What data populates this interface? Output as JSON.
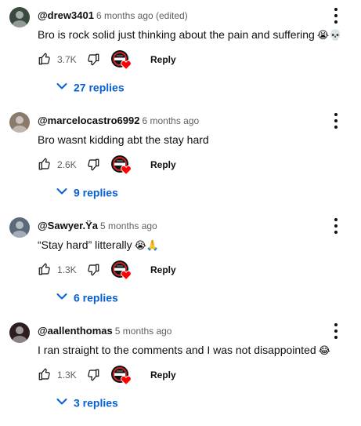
{
  "comments": [
    {
      "author": "@drew3401",
      "meta": "6 months ago (edited)",
      "text": "Bro is rock solid just thinking about the pain and suffering",
      "emojis": "😭💀",
      "likes": "3.7K",
      "reply_label": "Reply",
      "replies_label": "27 replies",
      "avatar_color": "#3a4a3f"
    },
    {
      "author": "@marcelocastro6992",
      "meta": "6 months ago",
      "text": "Bro wasnt kidding abt the stay hard",
      "emojis": "",
      "likes": "2.6K",
      "reply_label": "Reply",
      "replies_label": "9 replies",
      "avatar_color": "#8a7a6a"
    },
    {
      "author": "@Sawyer.Ÿa",
      "meta": "5 months ago",
      "text": "“Stay hard” litterally",
      "emojis": "😭🙏",
      "likes": "1.3K",
      "reply_label": "Reply",
      "replies_label": "6 replies",
      "avatar_color": "#5a6a78"
    },
    {
      "author": "@aallenthomas",
      "meta": "5 months ago",
      "text": "I ran straight to the comments and I was not disappointed",
      "emojis": "😂",
      "likes": "1.3K",
      "reply_label": "Reply",
      "replies_label": "3 replies",
      "avatar_color": "#2c1e1e"
    }
  ],
  "icons": {
    "like": "thumbs-up-icon",
    "dislike": "thumbs-down-icon",
    "more": "kebab-menu-icon",
    "expand": "chevron-down-icon",
    "creator_heart": "creator-heart-icon"
  },
  "colors": {
    "link_blue": "#065fd4",
    "meta_gray": "#606060",
    "heart_red": "#ff0000",
    "text": "#0f0f0f"
  }
}
